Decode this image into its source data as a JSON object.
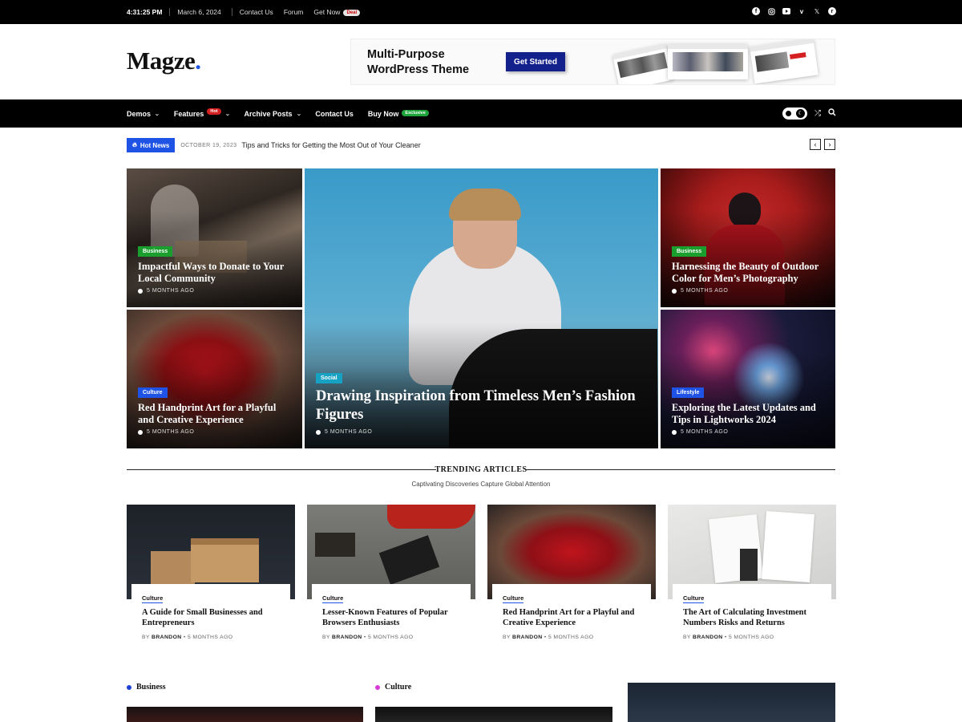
{
  "topbar": {
    "time": "4:31:25 PM",
    "date": "March 6, 2024",
    "links": [
      "Contact Us",
      "Forum",
      "Get Now"
    ],
    "deal_badge": "Deal",
    "social_icons": [
      "facebook-icon",
      "instagram-icon",
      "youtube-icon",
      "vimeo-icon",
      "x-icon",
      "reddit-icon"
    ]
  },
  "header": {
    "logo_text": "Magze",
    "logo_dot": ".",
    "ad_title": "Multi-Purpose WordPress Theme",
    "ad_button": "Get Started"
  },
  "nav": {
    "items": [
      {
        "label": "Demos"
      },
      {
        "label": "Features",
        "badge": "Hot"
      },
      {
        "label": "Archive Posts"
      },
      {
        "label": "Contact Us"
      },
      {
        "label": "Buy Now",
        "badge": "Exclusive"
      }
    ]
  },
  "ticker": {
    "label": "Hot News",
    "date": "OCTOBER 19, 2023",
    "headline": "Tips and Tricks for Getting the Most Out of Your Cleaner",
    "prev": "‹",
    "next": "›"
  },
  "hero": [
    {
      "category": "Business",
      "title": "Impactful Ways to Donate to Your Local Community",
      "meta": "5 MONTHS AGO"
    },
    {
      "category": "Culture",
      "title": "Red Handprint Art for a Playful and Creative Experience",
      "meta": "5 MONTHS AGO"
    },
    {
      "category": "Social",
      "title": "Drawing Inspiration from Timeless Men’s Fashion Figures",
      "meta": "5 MONTHS AGO"
    },
    {
      "category": "Business",
      "title": "Harnessing the Beauty of Outdoor Color for Men’s Photography",
      "meta": "5 MONTHS AGO"
    },
    {
      "category": "Lifestyle",
      "title": "Exploring the Latest Updates and Tips in Lightworks 2024",
      "meta": "5 MONTHS AGO"
    }
  ],
  "trending": {
    "title": "TRENDING ARTICLES",
    "subtitle": "Captivating Discoveries Capture Global Attention",
    "cards": [
      {
        "category": "Culture",
        "title": "A Guide for Small Businesses and Entrepreneurs",
        "by": "BY",
        "author": "BRANDON",
        "time": "5 MONTHS AGO"
      },
      {
        "category": "Culture",
        "title": "Lesser-Known Features of Popular Browsers Enthusiasts",
        "by": "BY",
        "author": "BRANDON",
        "time": "5 MONTHS AGO"
      },
      {
        "category": "Culture",
        "title": "Red Handprint Art for a Playful and Creative Experience",
        "by": "BY",
        "author": "BRANDON",
        "time": "5 MONTHS AGO"
      },
      {
        "category": "Culture",
        "title": "The Art of Calculating Investment Numbers Risks and Returns",
        "by": "BY",
        "author": "BRANDON",
        "time": "5 MONTHS AGO"
      }
    ]
  },
  "sections": [
    {
      "label": "Business",
      "color": "#1e3fd8"
    },
    {
      "label": "Culture",
      "color": "#d63bd6"
    }
  ],
  "colors": {
    "accent": "#1e53e5",
    "business": "#1a9e2e",
    "social": "#17a2c4"
  }
}
